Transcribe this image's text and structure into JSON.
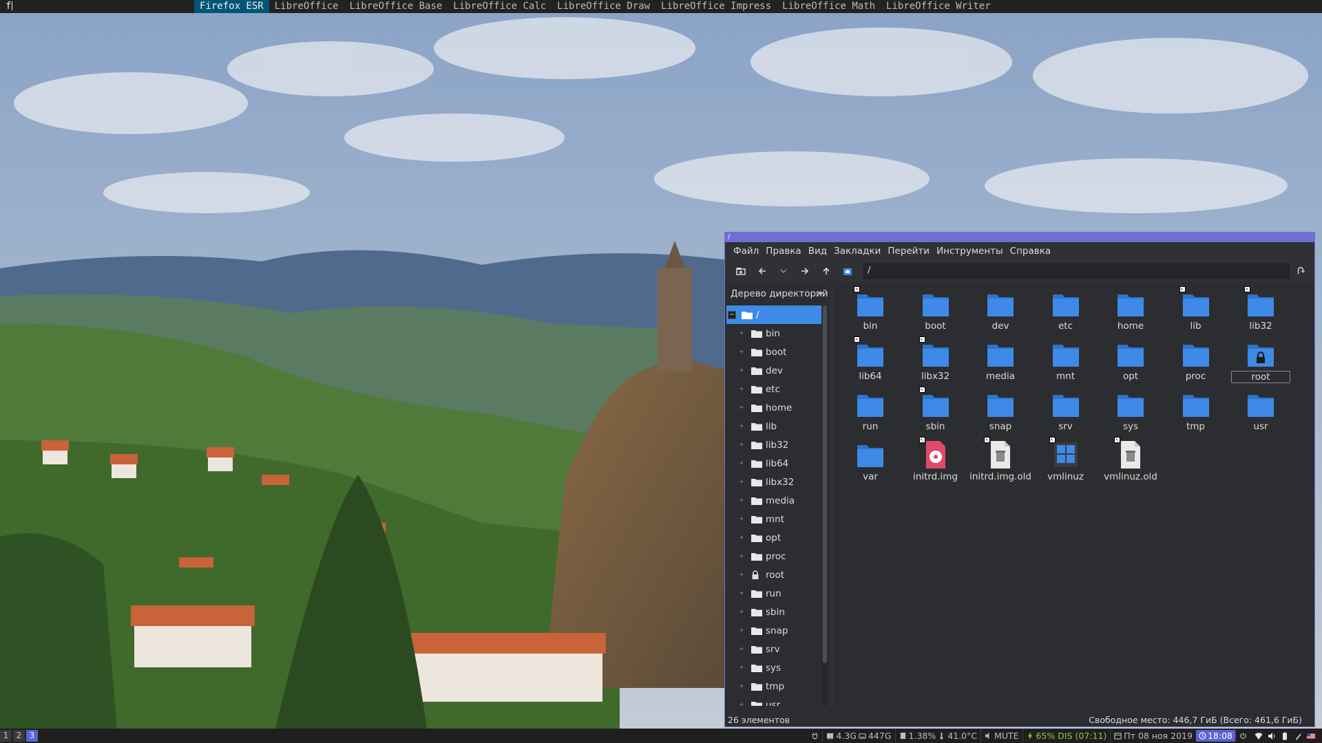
{
  "dmenu": {
    "input": "f",
    "items": [
      {
        "label": "Firefox ESR",
        "selected": true
      },
      {
        "label": "LibreOffice",
        "selected": false
      },
      {
        "label": "LibreOffice Base",
        "selected": false
      },
      {
        "label": "LibreOffice Calc",
        "selected": false
      },
      {
        "label": "LibreOffice Draw",
        "selected": false
      },
      {
        "label": "LibreOffice Impress",
        "selected": false
      },
      {
        "label": "LibreOffice Math",
        "selected": false
      },
      {
        "label": "LibreOffice Writer",
        "selected": false
      }
    ]
  },
  "file_manager": {
    "title": "/",
    "menu": [
      "Файл",
      "Правка",
      "Вид",
      "Закладки",
      "Перейти",
      "Инструменты",
      "Справка"
    ],
    "path": "/",
    "side_pane_title": "Дерево директорий",
    "tree_root": "/",
    "tree": [
      {
        "label": "bin",
        "icon": "folder-icon"
      },
      {
        "label": "boot",
        "icon": "folder-icon"
      },
      {
        "label": "dev",
        "icon": "folder-icon"
      },
      {
        "label": "etc",
        "icon": "folder-icon"
      },
      {
        "label": "home",
        "icon": "folder-icon"
      },
      {
        "label": "lib",
        "icon": "folder-icon"
      },
      {
        "label": "lib32",
        "icon": "folder-icon"
      },
      {
        "label": "lib64",
        "icon": "folder-icon"
      },
      {
        "label": "libx32",
        "icon": "folder-icon"
      },
      {
        "label": "media",
        "icon": "folder-icon"
      },
      {
        "label": "mnt",
        "icon": "folder-icon"
      },
      {
        "label": "opt",
        "icon": "folder-icon"
      },
      {
        "label": "proc",
        "icon": "folder-icon"
      },
      {
        "label": "root",
        "icon": "lock-icon"
      },
      {
        "label": "run",
        "icon": "folder-icon"
      },
      {
        "label": "sbin",
        "icon": "folder-icon"
      },
      {
        "label": "snap",
        "icon": "folder-icon"
      },
      {
        "label": "srv",
        "icon": "folder-icon"
      },
      {
        "label": "sys",
        "icon": "folder-icon"
      },
      {
        "label": "tmp",
        "icon": "folder-icon"
      },
      {
        "label": "usr",
        "icon": "folder-icon"
      }
    ],
    "items": [
      {
        "label": "bin",
        "type": "folder",
        "link": true
      },
      {
        "label": "boot",
        "type": "folder",
        "link": false
      },
      {
        "label": "dev",
        "type": "folder",
        "link": false
      },
      {
        "label": "etc",
        "type": "folder",
        "link": false
      },
      {
        "label": "home",
        "type": "folder",
        "link": false
      },
      {
        "label": "lib",
        "type": "folder",
        "link": true
      },
      {
        "label": "lib32",
        "type": "folder",
        "link": true
      },
      {
        "label": "lib64",
        "type": "folder",
        "link": true
      },
      {
        "label": "libx32",
        "type": "folder",
        "link": true
      },
      {
        "label": "media",
        "type": "folder",
        "link": false
      },
      {
        "label": "mnt",
        "type": "folder",
        "link": false
      },
      {
        "label": "opt",
        "type": "folder",
        "link": false
      },
      {
        "label": "proc",
        "type": "folder",
        "link": false
      },
      {
        "label": "root",
        "type": "locked-folder",
        "link": false,
        "focused": true
      },
      {
        "label": "run",
        "type": "folder",
        "link": false
      },
      {
        "label": "sbin",
        "type": "folder",
        "link": true
      },
      {
        "label": "snap",
        "type": "folder",
        "link": false
      },
      {
        "label": "srv",
        "type": "folder",
        "link": false
      },
      {
        "label": "sys",
        "type": "folder",
        "link": false
      },
      {
        "label": "tmp",
        "type": "folder",
        "link": false
      },
      {
        "label": "usr",
        "type": "folder",
        "link": false
      },
      {
        "label": "var",
        "type": "folder",
        "link": false
      },
      {
        "label": "initrd.img",
        "type": "disc-image",
        "link": true
      },
      {
        "label": "initrd.img.old",
        "type": "archive",
        "link": true
      },
      {
        "label": "vmlinuz",
        "type": "kernel",
        "link": true
      },
      {
        "label": "vmlinuz.old",
        "type": "archive",
        "link": true
      }
    ],
    "status_left": "26 элементов",
    "status_right": "Свободное место: 446,7 ГиБ (Всего: 461,6 ГиБ)"
  },
  "statusbar": {
    "tags": [
      {
        "label": "1",
        "selected": false
      },
      {
        "label": "2",
        "selected": false
      },
      {
        "label": "3",
        "selected": true
      }
    ],
    "mem": "4.3G",
    "disk": "447G",
    "cpu": "1.38%",
    "temp": "41.0°C",
    "volume": "MUTE",
    "battery": "65% DIS (07:11)",
    "date": "Пт 08 ноя 2019",
    "time": "18:08"
  },
  "colors": {
    "accent": "#5a62d6",
    "folder": "#3e8ae6",
    "selection": "#005577",
    "battery": "#8ccf3a"
  }
}
